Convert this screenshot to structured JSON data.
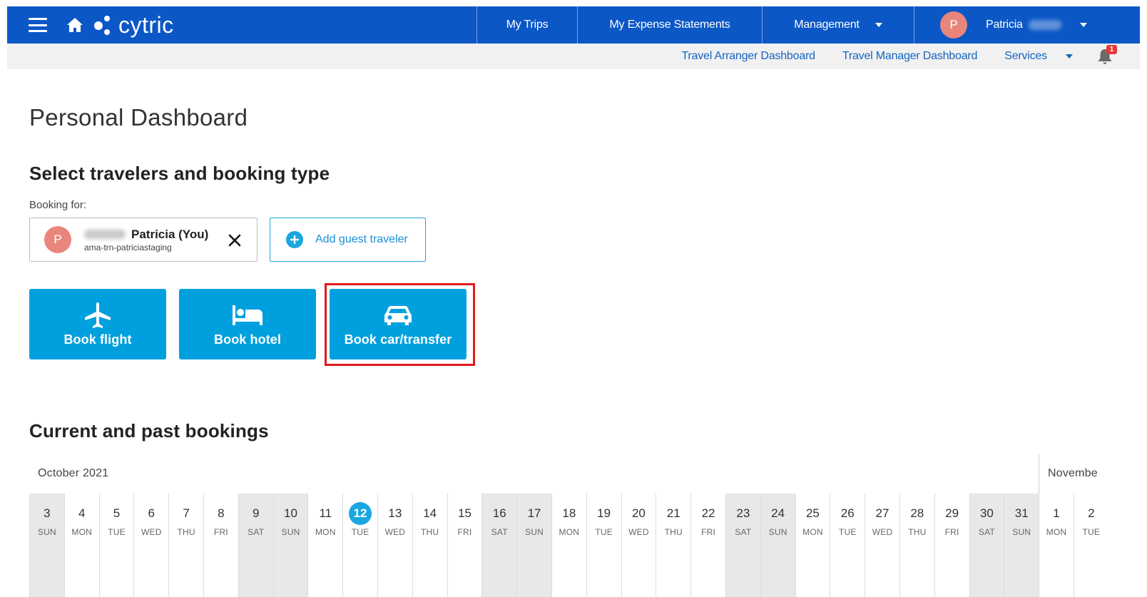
{
  "header": {
    "logo_text": "cytric",
    "nav": [
      {
        "label": "My Trips"
      },
      {
        "label": "My Expense Statements"
      },
      {
        "label": "Management"
      }
    ],
    "user": {
      "initial": "P",
      "name": "Patricia"
    }
  },
  "subnav": {
    "links": [
      "Travel Arranger Dashboard",
      "Travel Manager Dashboard",
      "Services"
    ],
    "notification_count": "1"
  },
  "page": {
    "title": "Personal Dashboard",
    "select_heading": "Select travelers and booking type",
    "booking_for_label": "Booking for:",
    "traveler": {
      "initial": "P",
      "name": "Patricia (You)",
      "username": "ama-trn-patriciastaging"
    },
    "add_guest_label": "Add guest traveler",
    "tiles": [
      {
        "label": "Book flight",
        "icon": "airplane-icon"
      },
      {
        "label": "Book hotel",
        "icon": "bed-icon"
      },
      {
        "label": "Book car/transfer",
        "icon": "car-icon"
      }
    ],
    "bookings_heading": "Current and past bookings"
  },
  "calendar": {
    "months": [
      "October 2021",
      "Novembe"
    ],
    "days": [
      {
        "num": "3",
        "dow": "SUN",
        "weekend": true
      },
      {
        "num": "4",
        "dow": "MON"
      },
      {
        "num": "5",
        "dow": "TUE"
      },
      {
        "num": "6",
        "dow": "WED"
      },
      {
        "num": "7",
        "dow": "THU"
      },
      {
        "num": "8",
        "dow": "FRI"
      },
      {
        "num": "9",
        "dow": "SAT",
        "weekend": true
      },
      {
        "num": "10",
        "dow": "SUN",
        "weekend": true
      },
      {
        "num": "11",
        "dow": "MON"
      },
      {
        "num": "12",
        "dow": "TUE",
        "today": true
      },
      {
        "num": "13",
        "dow": "WED"
      },
      {
        "num": "14",
        "dow": "THU"
      },
      {
        "num": "15",
        "dow": "FRI"
      },
      {
        "num": "16",
        "dow": "SAT",
        "weekend": true
      },
      {
        "num": "17",
        "dow": "SUN",
        "weekend": true
      },
      {
        "num": "18",
        "dow": "MON"
      },
      {
        "num": "19",
        "dow": "TUE"
      },
      {
        "num": "20",
        "dow": "WED"
      },
      {
        "num": "21",
        "dow": "THU"
      },
      {
        "num": "22",
        "dow": "FRI"
      },
      {
        "num": "23",
        "dow": "SAT",
        "weekend": true
      },
      {
        "num": "24",
        "dow": "SUN",
        "weekend": true
      },
      {
        "num": "25",
        "dow": "MON"
      },
      {
        "num": "26",
        "dow": "TUE"
      },
      {
        "num": "27",
        "dow": "WED"
      },
      {
        "num": "28",
        "dow": "THU"
      },
      {
        "num": "29",
        "dow": "FRI"
      },
      {
        "num": "30",
        "dow": "SAT",
        "weekend": true
      },
      {
        "num": "31",
        "dow": "SUN",
        "weekend": true
      },
      {
        "num": "1",
        "dow": "MON"
      },
      {
        "num": "2",
        "dow": "TUE"
      }
    ]
  },
  "colors": {
    "topbar": "#0b57c6",
    "tile": "#00a0df",
    "highlight": "#e21a1a",
    "today": "#1aa7e0"
  }
}
